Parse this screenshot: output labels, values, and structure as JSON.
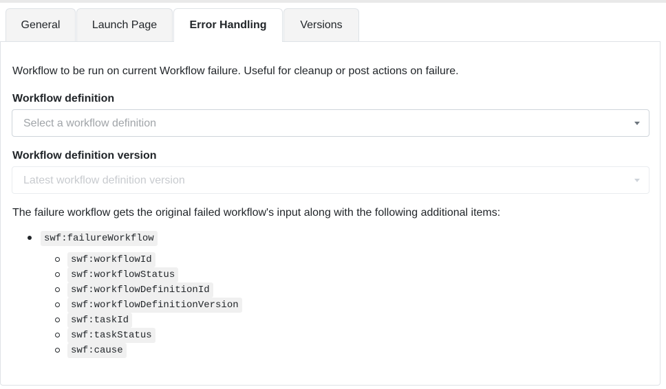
{
  "tabs": [
    {
      "label": "General"
    },
    {
      "label": "Launch Page"
    },
    {
      "label": "Error Handling",
      "active": true
    },
    {
      "label": "Versions"
    }
  ],
  "panel": {
    "description": "Workflow to be run on current Workflow failure. Useful for cleanup or post actions on failure.",
    "workflow_definition": {
      "label": "Workflow definition",
      "placeholder": "Select a workflow definition"
    },
    "workflow_definition_version": {
      "label": "Workflow definition version",
      "placeholder": "Latest workflow definition version",
      "disabled": true
    },
    "info_text": "The failure workflow gets the original failed workflow's input along with the following additional items:",
    "items": {
      "main": "swf:failureWorkflow",
      "sub": [
        "swf:workflowId",
        "swf:workflowStatus",
        "swf:workflowDefinitionId",
        "swf:workflowDefinitionVersion",
        "swf:taskId",
        "swf:taskStatus",
        "swf:cause"
      ]
    }
  }
}
